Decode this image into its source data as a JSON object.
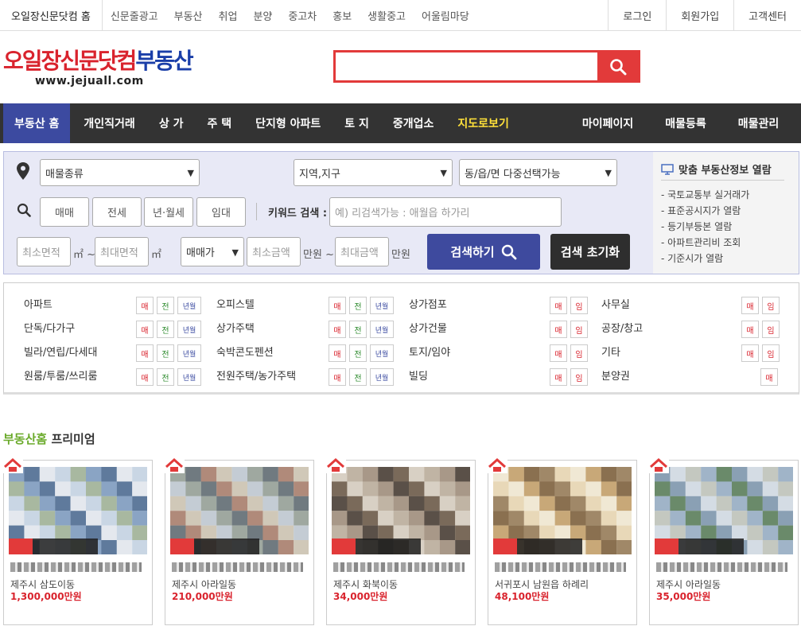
{
  "topbar": {
    "home": "오일장신문닷컴 홈",
    "links": [
      "신문줄광고",
      "부동산",
      "취업",
      "분양",
      "중고차",
      "홍보",
      "생활중고",
      "어울림마당"
    ],
    "right": [
      "로그인",
      "회원가입",
      "고객센터"
    ]
  },
  "logo": {
    "brand_red": "오일장신문닷컴",
    "brand_blue": "부동산",
    "sub": "www.jejuall.com"
  },
  "search": {
    "placeholder": ""
  },
  "nav": {
    "items": [
      "부동산 홈",
      "개인직거래",
      "상 가",
      "주 택",
      "단지형 아파트",
      "토 지",
      "중개업소",
      "지도로보기"
    ],
    "right": [
      "마이페이지",
      "매물등록",
      "매물관리"
    ]
  },
  "panel": {
    "type_select": "매물종류",
    "region_select": "지역,지구",
    "dong_select": "동/읍/면 다중선택가능",
    "deal_buttons": [
      "매매",
      "전세",
      "년·월세",
      "임대"
    ],
    "keyword_label": "키워드 검색 :",
    "keyword_placeholder": "예) 리검색가능 : 애월읍 하가리",
    "min_area": "최소면적",
    "max_area": "최대면적",
    "area_unit": "㎡",
    "tilde": "~",
    "price_type": "매매가",
    "min_price": "최소금액",
    "max_price": "최대금액",
    "price_unit": "만원",
    "search_btn": "검색하기",
    "reset_btn": "검색 초기화",
    "info_title": "맞춤 부동산정보 열람",
    "info_links": [
      "- 국토교통부 실거래가",
      "- 표준공시지가 열람",
      "- 등기부등본 열람",
      "- 아파트관리비 조회",
      "- 기준시가 열람"
    ]
  },
  "categories": {
    "col1": [
      "아파트",
      "단독/다가구",
      "빌라/연립/다세대",
      "원룸/투룸/쓰리룸"
    ],
    "col2": [
      "오피스텔",
      "상가주택",
      "숙박콘도펜션",
      "전원주택/농가주택"
    ],
    "col3": [
      "상가점포",
      "상가건물",
      "토지/임야",
      "빌딩"
    ],
    "col4": [
      "사무실",
      "공장/창고",
      "기타",
      "분양권"
    ],
    "tag_sale": "매",
    "tag_jeonse": "전",
    "tag_rent": "년월",
    "tag_lease": "임"
  },
  "premium": {
    "title_green": "부동산홈",
    "title_black": "프리미엄",
    "cards": [
      {
        "loc": "제주시 삼도이동",
        "price": "1,300,000만원"
      },
      {
        "loc": "제주시 아라일동",
        "price": "210,000만원"
      },
      {
        "loc": "제주시 화북이동",
        "price": "34,000만원"
      },
      {
        "loc": "서귀포시 남원읍 하례리",
        "price": "48,100만원"
      },
      {
        "loc": "제주시 아라일동",
        "price": "35,000만원"
      }
    ]
  },
  "colors": {
    "accent_red": "#e23a3a",
    "nav_active": "#3c4aa0",
    "nav_bg": "#333333",
    "map_link": "#ffe13a"
  }
}
